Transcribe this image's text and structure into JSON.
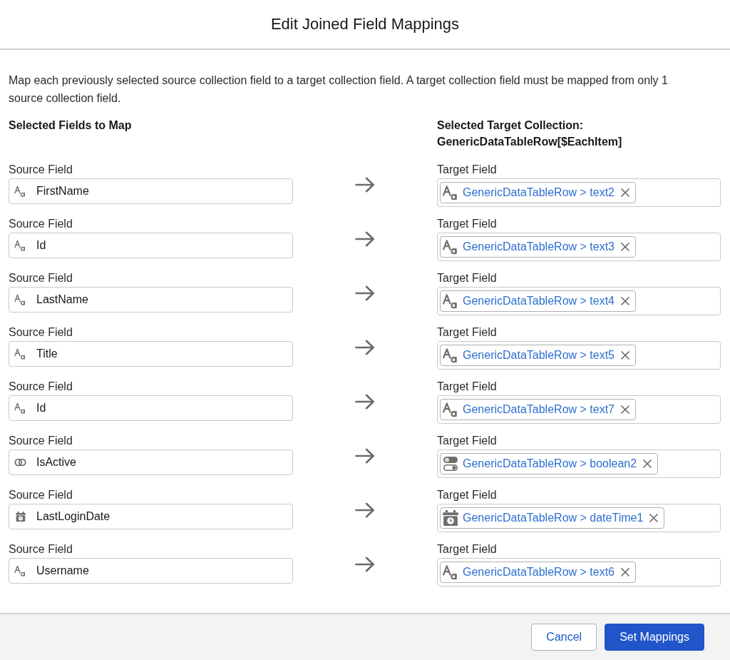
{
  "dialog": {
    "title": "Edit Joined Field Mappings"
  },
  "description": "Map each previously selected source collection field to a target collection field. A target collection field must be mapped from only 1 source collection field.",
  "source_column": {
    "heading": "Selected Fields to Map"
  },
  "target_column": {
    "heading": "Selected Target Collection: GenericDataTableRow[$EachItem]"
  },
  "rows": [
    {
      "source_label": "Source Field",
      "source": {
        "kind": "text",
        "value": "FirstName"
      },
      "target_label": "Target Field",
      "target": {
        "kind": "text",
        "value": "GenericDataTableRow > text2"
      }
    },
    {
      "source_label": "Source Field",
      "source": {
        "kind": "text",
        "value": "Id"
      },
      "target_label": "Target Field",
      "target": {
        "kind": "text",
        "value": "GenericDataTableRow > text3"
      }
    },
    {
      "source_label": "Source Field",
      "source": {
        "kind": "text",
        "value": "LastName"
      },
      "target_label": "Target Field",
      "target": {
        "kind": "text",
        "value": "GenericDataTableRow > text4"
      }
    },
    {
      "source_label": "Source Field",
      "source": {
        "kind": "text",
        "value": "Title"
      },
      "target_label": "Target Field",
      "target": {
        "kind": "text",
        "value": "GenericDataTableRow > text5"
      }
    },
    {
      "source_label": "Source Field",
      "source": {
        "kind": "text",
        "value": "Id"
      },
      "target_label": "Target Field",
      "target": {
        "kind": "text",
        "value": "GenericDataTableRow > text7"
      }
    },
    {
      "source_label": "Source Field",
      "source": {
        "kind": "boolean",
        "value": "IsActive"
      },
      "target_label": "Target Field",
      "target": {
        "kind": "boolean",
        "value": "GenericDataTableRow > boolean2"
      }
    },
    {
      "source_label": "Source Field",
      "source": {
        "kind": "datetime",
        "value": "LastLoginDate"
      },
      "target_label": "Target Field",
      "target": {
        "kind": "datetime",
        "value": "GenericDataTableRow > dateTime1"
      }
    },
    {
      "source_label": "Source Field",
      "source": {
        "kind": "text",
        "value": "Username"
      },
      "target_label": "Target Field",
      "target": {
        "kind": "text",
        "value": "GenericDataTableRow > text6"
      }
    }
  ],
  "footer": {
    "buttons": [
      {
        "label": "Cancel",
        "kind": "neutral"
      },
      {
        "label": "Set Mappings",
        "kind": "brand"
      }
    ]
  }
}
